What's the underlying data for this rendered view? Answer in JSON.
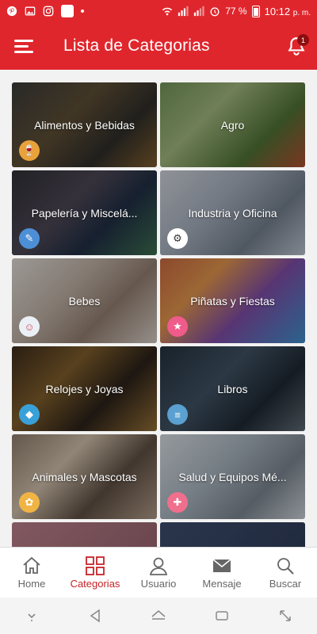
{
  "status_bar": {
    "battery": "77 %",
    "time": "10:12",
    "ampm": "p. m.",
    "wifi_badge": "2"
  },
  "app_bar": {
    "title": "Lista de Categorias",
    "notification_count": "1"
  },
  "categories": [
    {
      "label": "Alimentos y Bebidas",
      "icon": "food-drink-icon",
      "glyph": "🍷"
    },
    {
      "label": "Agro",
      "icon": "none",
      "glyph": ""
    },
    {
      "label": "Papelería y Miscelá...",
      "icon": "stationery-icon",
      "glyph": "✎"
    },
    {
      "label": "Industria y Oficina",
      "icon": "office-icon",
      "glyph": "⚙"
    },
    {
      "label": "Bebes",
      "icon": "baby-icon",
      "glyph": "☺"
    },
    {
      "label": "Piñatas y Fiestas",
      "icon": "party-icon",
      "glyph": "★"
    },
    {
      "label": "Relojes y Joyas",
      "icon": "jewelry-icon",
      "glyph": "◆"
    },
    {
      "label": "Libros",
      "icon": "books-icon",
      "glyph": "≡"
    },
    {
      "label": "Animales y Mascotas",
      "icon": "pet-icon",
      "glyph": "✿"
    },
    {
      "label": "Salud y Equipos Mé...",
      "icon": "health-icon",
      "glyph": "✚"
    },
    {
      "label": "",
      "icon": "none",
      "glyph": ""
    },
    {
      "label": "",
      "icon": "none",
      "glyph": ""
    }
  ],
  "bottom_nav": {
    "home": "Home",
    "categories": "Categorias",
    "user": "Usuario",
    "message": "Mensaje",
    "search": "Buscar",
    "active": "categories",
    "active_color": "#c62328"
  },
  "colors": {
    "primary": "#e0262d"
  }
}
